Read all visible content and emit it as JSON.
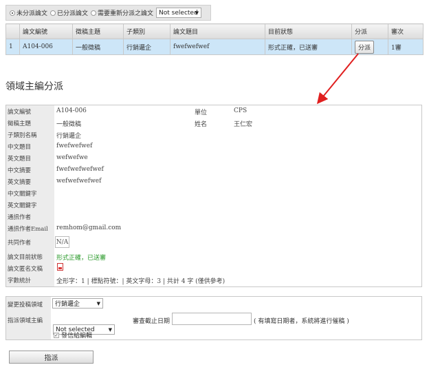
{
  "filter": {
    "options": [
      "未分派論文",
      "已分派論文",
      "需要重新分派之論文"
    ],
    "selected_index": 0,
    "dropdown_value": "Not selected"
  },
  "list_table": {
    "headers": [
      "",
      "論文編號",
      "徵稿主題",
      "子類別",
      "論文題目",
      "目前狀態",
      "分派",
      "審次"
    ],
    "rows": [
      [
        "1",
        "A104-006",
        "一般徵稿",
        "行銷邏企",
        "fwefwefwef",
        "形式正確，已送審",
        "分派",
        "1審"
      ]
    ]
  },
  "section_title": "領域主編分派",
  "info": {
    "rows": [
      {
        "label": "論文編號",
        "value": "A104-006"
      },
      {
        "label": "徵稿主題",
        "value": "一般徵稿"
      },
      {
        "label": "子類別名稱",
        "value": "行銷邏企"
      },
      {
        "label": "中文題目",
        "value": "fwefwefwef"
      },
      {
        "label": "英文題目",
        "value": "wefwefwe"
      },
      {
        "label": "中文摘要",
        "value": "fwefwefwefwef"
      },
      {
        "label": "英文摘要",
        "value": "wefwefwefwef"
      },
      {
        "label": "中文關鍵字",
        "value": ""
      },
      {
        "label": "英文關鍵字",
        "value": ""
      },
      {
        "label": "通訊作者",
        "value": ""
      },
      {
        "label": "通訊作者Email",
        "value": "remhom@gmail.com"
      },
      {
        "label": "共同作者",
        "value": "N/A"
      },
      {
        "label": "論文目前狀態",
        "value": "形式正確，已送審"
      },
      {
        "label": "論文匿名文稿",
        "value": ""
      },
      {
        "label": "字數統計",
        "value": "全形字：1 | 標點符號：| 英文字母：3 | 共計 4 字 (僅供參考)"
      }
    ],
    "right": [
      {
        "label": "單位",
        "value": "CPS"
      },
      {
        "label": "姓名",
        "value": "王仁宏"
      }
    ]
  },
  "form": {
    "change_field_label": "變更投稿領域",
    "change_field_value": "行銷邏企",
    "assign_editor_label": "指派領域主編",
    "assign_editor_value": "Not selected",
    "deadline_label": "審查截止日期",
    "deadline_value": "",
    "deadline_hint": "( 有填寫日期者，系統將進行催稿 )",
    "notify_label": "發信給編輯",
    "notify_checked": true
  },
  "submit_label": "指派",
  "colors": {
    "selected_row": "#cde6f8",
    "status_green": "#2a9a2a",
    "annotation_arrow": "#e02020"
  }
}
